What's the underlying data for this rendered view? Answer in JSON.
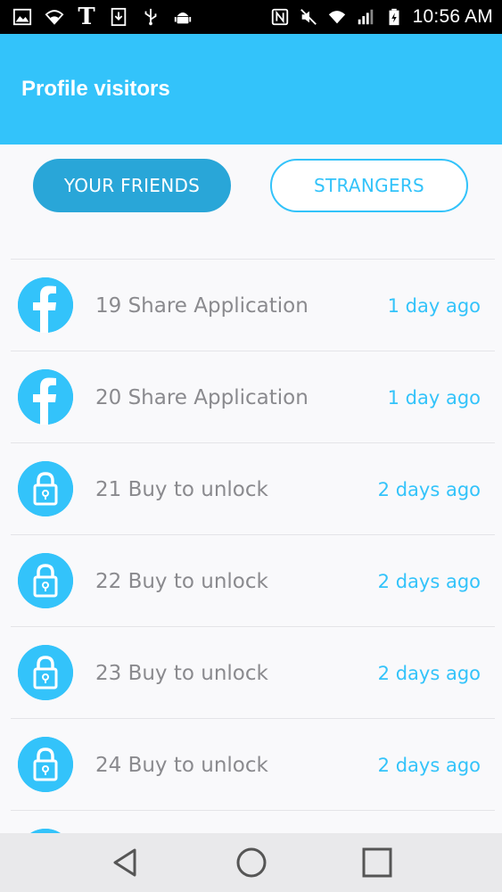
{
  "status_bar": {
    "time": "10:56 AM",
    "carrier_mark": "T",
    "icons_left": [
      "image-icon",
      "wifi-icon",
      "t-mobile-icon",
      "download-icon",
      "usb-icon",
      "android-icon"
    ],
    "icons_right": [
      "nfc-icon",
      "mute-icon",
      "wifi-icon",
      "signal-icon",
      "battery-icon"
    ]
  },
  "app_bar": {
    "title": "Profile visitors"
  },
  "tabs": {
    "friends": "YOUR FRIENDS",
    "strangers": "STRANGERS"
  },
  "visitors": [
    {
      "label": "19 Share Application",
      "time": "1 day ago",
      "icon": "facebook-icon"
    },
    {
      "label": "20 Share Application",
      "time": "1 day ago",
      "icon": "facebook-icon"
    },
    {
      "label": "21 Buy to unlock",
      "time": "2 days ago",
      "icon": "lock-icon"
    },
    {
      "label": "22 Buy to unlock",
      "time": "2 days ago",
      "icon": "lock-icon"
    },
    {
      "label": "23 Buy to unlock",
      "time": "2 days ago",
      "icon": "lock-icon"
    },
    {
      "label": "24 Buy to unlock",
      "time": "2 days ago",
      "icon": "lock-icon"
    }
  ],
  "colors": {
    "primary": "#33c3fa",
    "primary_dark": "#29a6d8",
    "text_gray": "#8a8a8e"
  },
  "nav_bar": {
    "icons": [
      "back-icon",
      "home-icon",
      "recents-icon"
    ]
  }
}
